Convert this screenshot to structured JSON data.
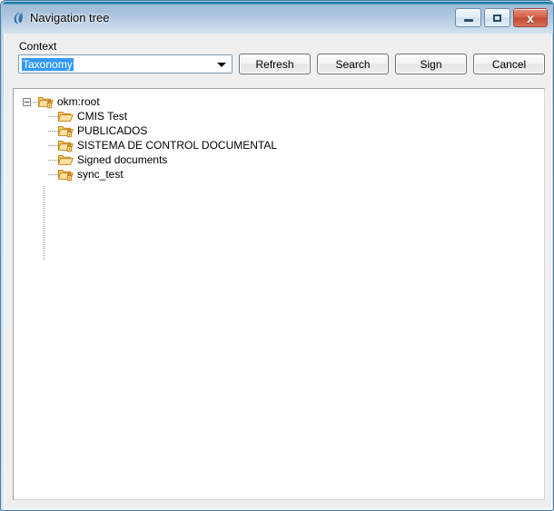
{
  "window": {
    "title": "Navigation tree",
    "icon": "app-logo-icon",
    "controls": [
      {
        "name": "minimize",
        "glyph": "minimize-icon",
        "label": ""
      },
      {
        "name": "maximize",
        "glyph": "maximize-icon",
        "label": ""
      },
      {
        "name": "close",
        "glyph": "close-icon",
        "label": "x"
      }
    ]
  },
  "form": {
    "context_label": "Context",
    "combo": {
      "value": "Taxonomy",
      "selected": true,
      "arrow_icon": "chevron-down-icon"
    },
    "buttons": [
      {
        "name": "refresh-button",
        "label": "Refresh"
      },
      {
        "name": "search-button",
        "label": "Search"
      },
      {
        "name": "sign-button",
        "label": "Sign"
      },
      {
        "name": "cancel-button",
        "label": "Cancel"
      }
    ]
  },
  "tree": {
    "root": {
      "label": "okm:root",
      "icon": "folder-locked-icon",
      "expanded": true,
      "toggle_icon": "collapse-minus-icon"
    },
    "children": [
      {
        "label": "CMIS Test",
        "icon": "folder-open-icon",
        "locked": false
      },
      {
        "label": "PUBLICADOS",
        "icon": "folder-locked-icon",
        "locked": true
      },
      {
        "label": "SISTEMA DE CONTROL DOCUMENTAL",
        "icon": "folder-locked-icon",
        "locked": true
      },
      {
        "label": "Signed documents",
        "icon": "folder-open-icon",
        "locked": false
      },
      {
        "label": "sync_test",
        "icon": "folder-locked-icon",
        "locked": true
      }
    ]
  },
  "colors": {
    "titlebar_top": "#1b7fa0",
    "titlebar_gradient_start": "#9fbbd6",
    "titlebar_gradient_end": "#d4e2ee",
    "dialog_background": "#efefef",
    "selection_blue": "#3399ff",
    "folder_orange": "#e8a33d",
    "close_button_red": "#c14a31",
    "tree_background": "#ffffff"
  }
}
